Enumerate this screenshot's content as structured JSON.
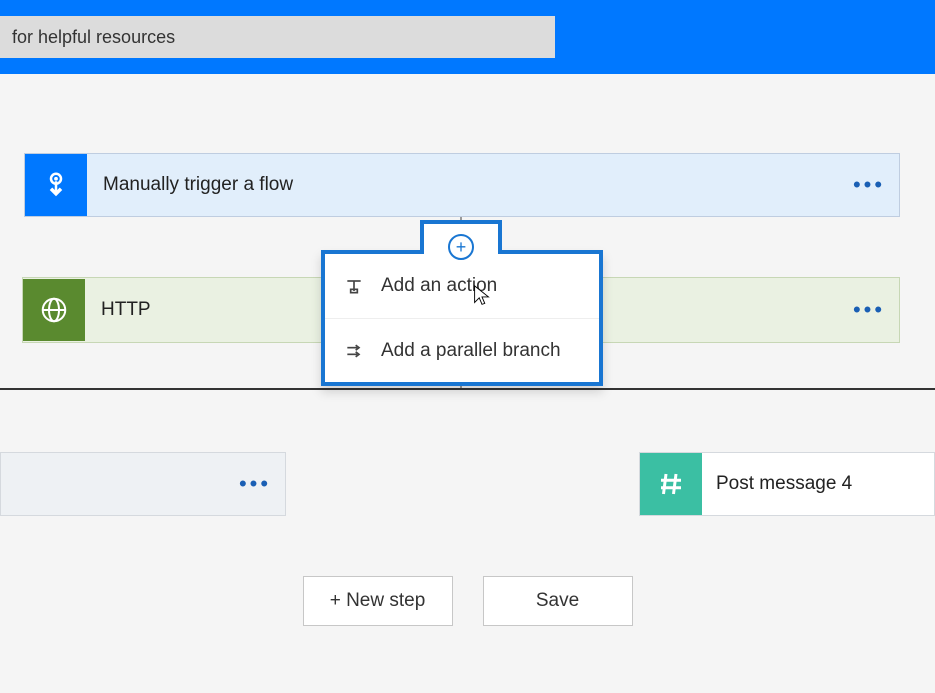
{
  "header": {
    "search_value": "for helpful resources"
  },
  "steps": {
    "trigger": {
      "title": "Manually trigger a flow"
    },
    "http": {
      "title": "HTTP"
    },
    "post": {
      "title": "Post message 4"
    }
  },
  "insert_menu": {
    "add_action": "Add an action",
    "add_parallel": "Add a parallel branch"
  },
  "buttons": {
    "new_step": "+ New step",
    "save": "Save"
  }
}
